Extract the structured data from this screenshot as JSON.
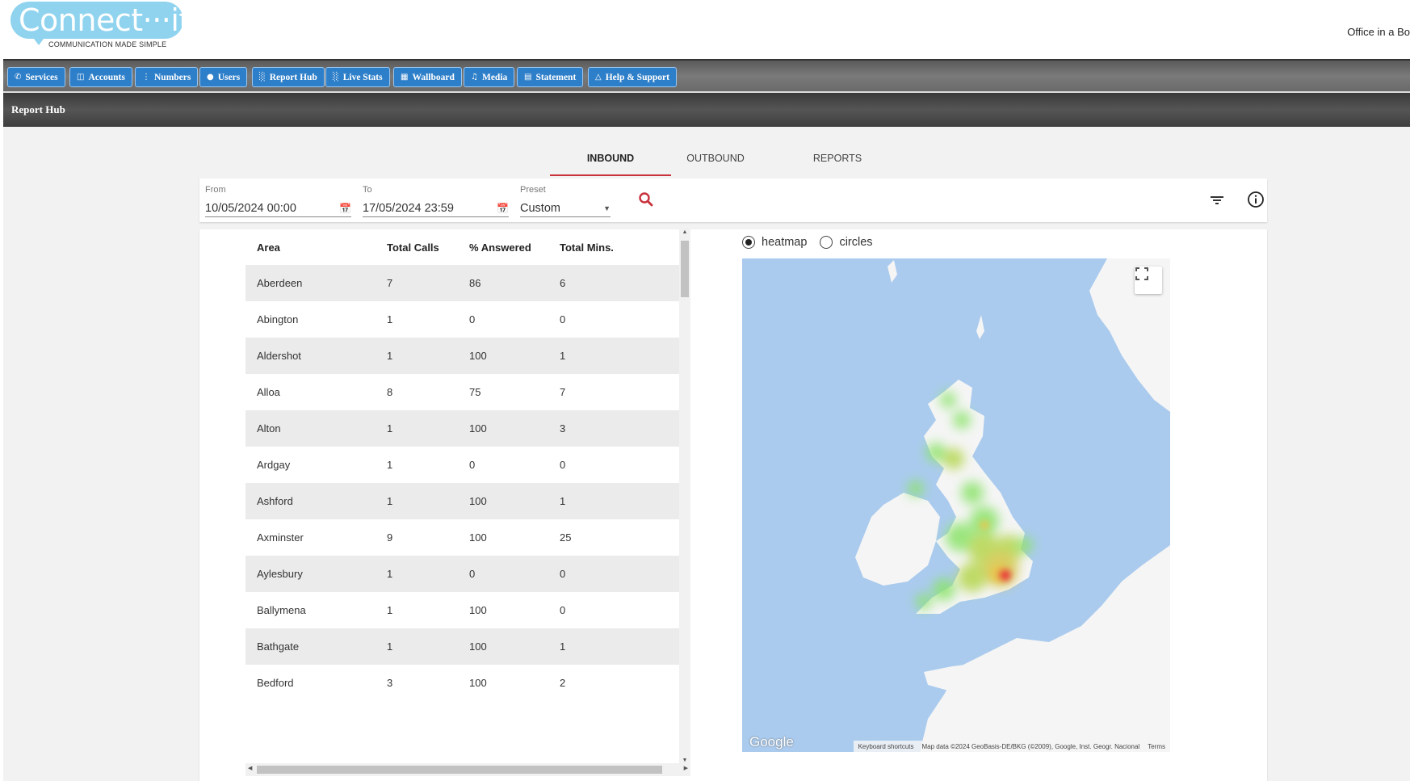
{
  "header": {
    "logo_text": "Connect···it",
    "logo_tagline": "COMMUNICATION MADE SIMPLE",
    "office_link": "Office in a Bo"
  },
  "nav": {
    "items": [
      {
        "label": "Services",
        "icon": "phone-icon"
      },
      {
        "label": "Accounts",
        "icon": "document-icon"
      },
      {
        "label": "Numbers",
        "icon": "keypad-icon"
      },
      {
        "label": "Users",
        "icon": "user-icon"
      },
      {
        "label": "Report Hub",
        "icon": "bar-chart-icon"
      },
      {
        "label": "Live Stats",
        "icon": "bar-chart-icon"
      },
      {
        "label": "Wallboard",
        "icon": "grid-icon"
      },
      {
        "label": "Media",
        "icon": "headphones-icon"
      },
      {
        "label": "Statement",
        "icon": "statement-icon"
      },
      {
        "label": "Help & Support",
        "icon": "warning-icon"
      }
    ]
  },
  "page": {
    "title": "Report Hub"
  },
  "tabs": [
    {
      "label": "INBOUND",
      "active": true
    },
    {
      "label": "OUTBOUND",
      "active": false
    },
    {
      "label": "REPORTS",
      "active": false
    }
  ],
  "filters": {
    "from_label": "From",
    "from_value": "10/05/2024 00:00",
    "to_label": "To",
    "to_value": "17/05/2024 23:59",
    "preset_label": "Preset",
    "preset_value": "Custom"
  },
  "table": {
    "columns": [
      "Area",
      "Total Calls",
      "% Answered",
      "Total Mins."
    ],
    "rows": [
      [
        "Aberdeen",
        "7",
        "86",
        "6"
      ],
      [
        "Abington",
        "1",
        "0",
        "0"
      ],
      [
        "Aldershot",
        "1",
        "100",
        "1"
      ],
      [
        "Alloa",
        "8",
        "75",
        "7"
      ],
      [
        "Alton",
        "1",
        "100",
        "3"
      ],
      [
        "Ardgay",
        "1",
        "0",
        "0"
      ],
      [
        "Ashford",
        "1",
        "100",
        "1"
      ],
      [
        "Axminster",
        "9",
        "100",
        "25"
      ],
      [
        "Aylesbury",
        "1",
        "0",
        "0"
      ],
      [
        "Ballymena",
        "1",
        "100",
        "0"
      ],
      [
        "Bathgate",
        "1",
        "100",
        "1"
      ],
      [
        "Bedford",
        "3",
        "100",
        "2"
      ]
    ]
  },
  "map": {
    "mode_options": [
      {
        "label": "heatmap",
        "selected": true
      },
      {
        "label": "circles",
        "selected": false
      }
    ],
    "google_logo": "Google",
    "attribution": {
      "shortcuts": "Keyboard shortcuts",
      "data": "Map data ©2024 GeoBasis-DE/BKG (©2009), Google, Inst. Geogr. Nacional",
      "terms": "Terms"
    },
    "colors": {
      "water": "#aacbee",
      "land": "#f5f5f5",
      "heat_low": "#8be36a",
      "heat_mid": "#e8c850",
      "heat_high": "#e8403a"
    }
  },
  "colors": {
    "nav_button": "#2e7fc9",
    "tab_active_underline": "#c8323c",
    "search_icon": "#c8323c",
    "logo": "#8fd3ee"
  }
}
